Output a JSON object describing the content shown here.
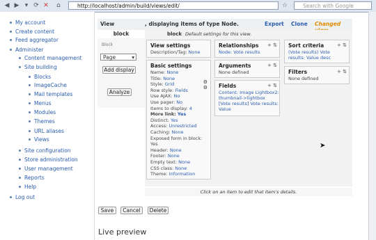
{
  "browser": {
    "url": "http://localhost/admin/build/views/edit/",
    "search_placeholder": "Search with Google"
  },
  "sidebar": {
    "items": [
      {
        "label": "My account"
      },
      {
        "label": "Create content"
      },
      {
        "label": "Feed aggregator"
      },
      {
        "label": "Administer"
      },
      {
        "label": "Content management"
      },
      {
        "label": "Site building"
      },
      {
        "label": "Blocks"
      },
      {
        "label": "ImageCache"
      },
      {
        "label": "Mail templates"
      },
      {
        "label": "Menus"
      },
      {
        "label": "Modules"
      },
      {
        "label": "Themes"
      },
      {
        "label": "URL aliases"
      },
      {
        "label": "Views"
      },
      {
        "label": "Site configuration"
      },
      {
        "label": "Store administration"
      },
      {
        "label": "User management"
      },
      {
        "label": "Reports"
      },
      {
        "label": "Help"
      },
      {
        "label": "Log out"
      }
    ]
  },
  "view_header": {
    "left": "View",
    "middle": ", displaying items of type Node.",
    "export": "Export",
    "clone": "Clone",
    "changed": "Changed view"
  },
  "display_tab": {
    "label": "block",
    "sub": "Block",
    "select_value": "Page",
    "add_display": "Add display",
    "analyze": "Analyze"
  },
  "block_bar": {
    "name": "block",
    "desc": "Default settings for this view."
  },
  "view_settings": {
    "title": "View settings",
    "row": "Description/Tag:",
    "row_link": "None"
  },
  "basic_settings": {
    "title": "Basic settings",
    "rows": [
      {
        "label": "Name:",
        "value": "None"
      },
      {
        "label": "Title:",
        "value": "None"
      },
      {
        "label": "Style:",
        "value": "Grid"
      },
      {
        "label": "Row style:",
        "value": "Fields"
      },
      {
        "label": "Use AJAX:",
        "value": "No"
      },
      {
        "label": "Use pager:",
        "value": "No"
      },
      {
        "label": "Items to display:",
        "value": "4"
      },
      {
        "label": "More link:",
        "value": "Yes"
      },
      {
        "label": "Distinct:",
        "value": "Yes"
      },
      {
        "label": "Access:",
        "value": "Unrestricted"
      },
      {
        "label": "Caching:",
        "value": "None"
      },
      {
        "label": "Exposed form in block:",
        "value": ""
      },
      {
        "label": "Yes",
        "value": ""
      },
      {
        "label": "Header:",
        "value": "None"
      },
      {
        "label": "Footer:",
        "value": "None"
      },
      {
        "label": "Empty text:",
        "value": "None"
      },
      {
        "label": "CSS class:",
        "value": "None"
      },
      {
        "label": "Theme:",
        "value": "Information"
      }
    ]
  },
  "relationships": {
    "title": "Relationships",
    "row": "Node: Vote results"
  },
  "arguments": {
    "title": "Arguments",
    "row": "None defined"
  },
  "fields": {
    "title": "Fields",
    "lines": [
      "Content: Image Lightbox2:",
      "thumbnail->lightbox",
      "[Vote results] Vote results:",
      "Value"
    ]
  },
  "sort_criteria": {
    "title": "Sort criteria",
    "lines": [
      "(Vote results) Vote",
      "results: Value desc"
    ]
  },
  "filters": {
    "title": "Filters",
    "row": "None defined"
  },
  "footer_note": "Click on an item to edit that item's details.",
  "buttons": {
    "save": "Save",
    "cancel": "Cancel",
    "delete": "Delete"
  },
  "live_preview": "Live preview"
}
